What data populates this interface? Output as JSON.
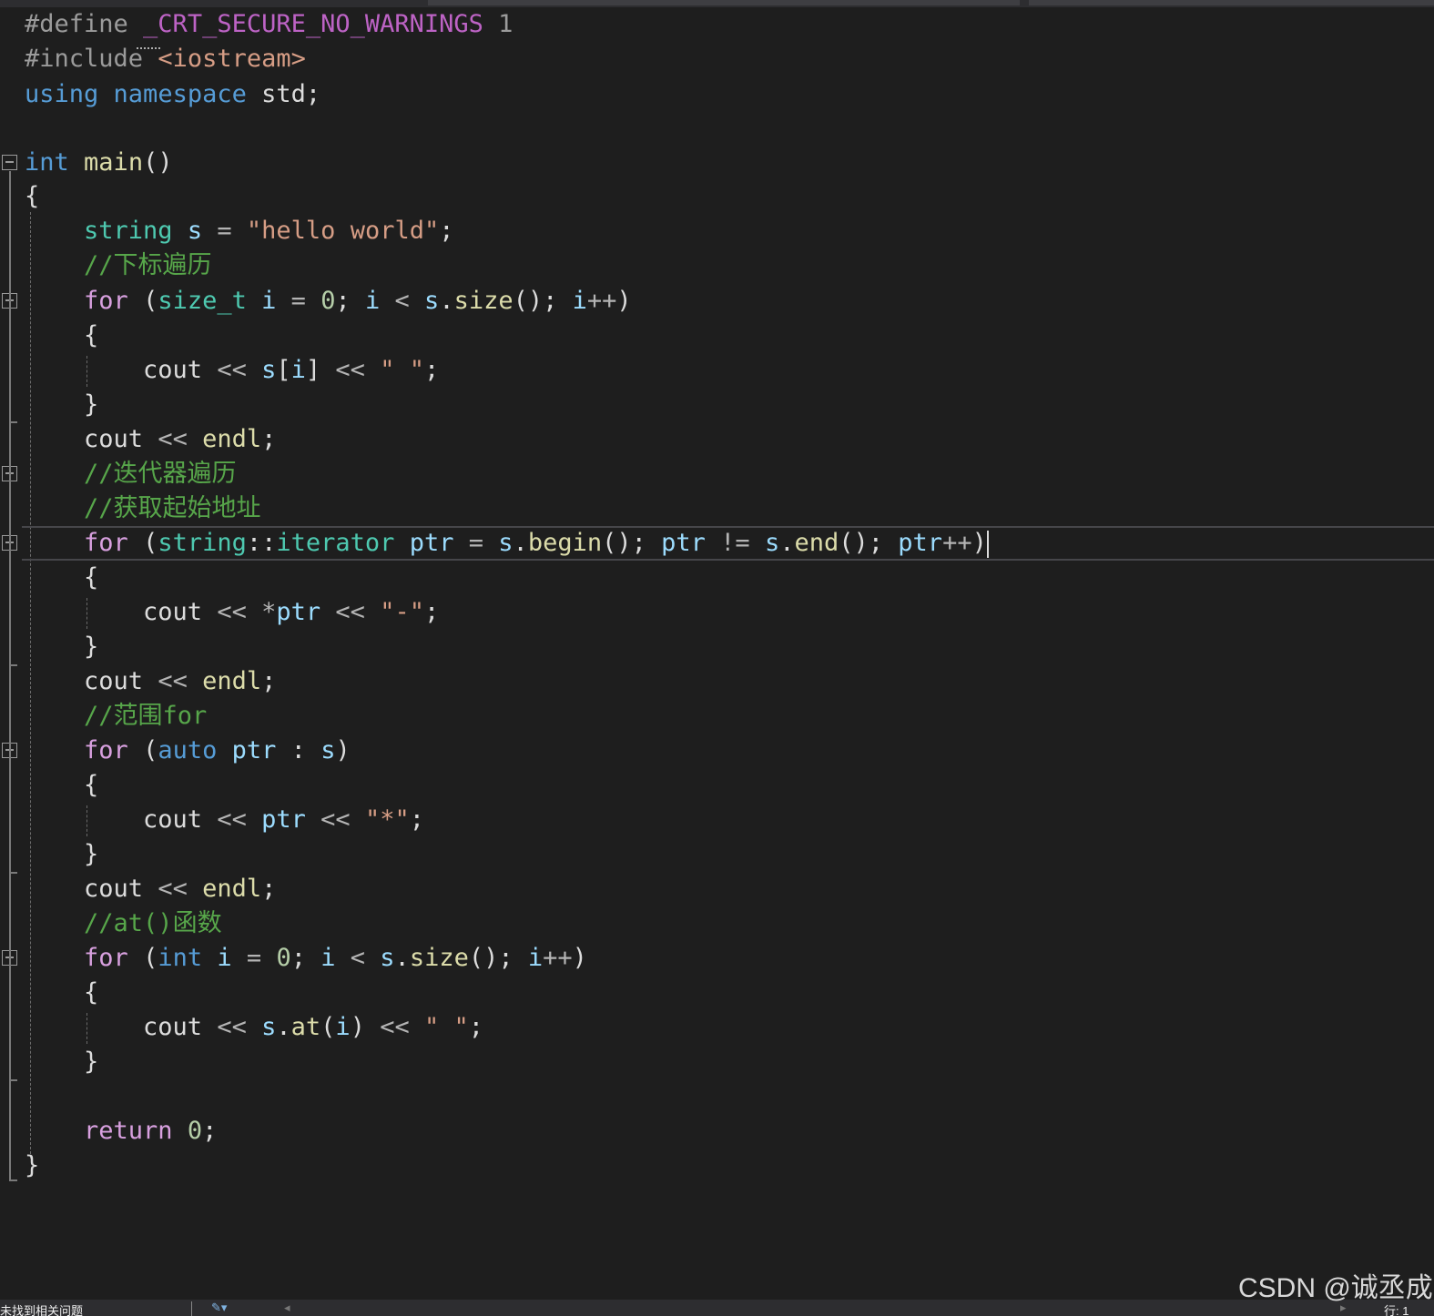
{
  "editor": {
    "lines": [
      [
        {
          "c": "t-pre",
          "t": "#define "
        },
        {
          "c": "t-macro",
          "t": "_CRT_SECURE_NO_WARNINGS"
        },
        {
          "c": "t-pre",
          "t": " 1"
        }
      ],
      [
        {
          "c": "t-pre",
          "t": "#include "
        },
        {
          "c": "t-str",
          "t": "<iostream>"
        }
      ],
      [
        {
          "c": "t-kw",
          "t": "using"
        },
        {
          "c": "",
          "t": " "
        },
        {
          "c": "t-kw",
          "t": "namespace"
        },
        {
          "c": "",
          "t": " std;"
        }
      ],
      [],
      [
        {
          "c": "t-kw",
          "t": "int"
        },
        {
          "c": "",
          "t": " "
        },
        {
          "c": "t-fn",
          "t": "main"
        },
        {
          "c": "",
          "t": "()"
        }
      ],
      [
        {
          "c": "",
          "t": "{"
        }
      ],
      [
        {
          "c": "",
          "t": "    "
        },
        {
          "c": "t-type",
          "t": "string"
        },
        {
          "c": "",
          "t": " "
        },
        {
          "c": "t-var",
          "t": "s"
        },
        {
          "c": "",
          "t": " "
        },
        {
          "c": "t-op",
          "t": "="
        },
        {
          "c": "",
          "t": " "
        },
        {
          "c": "t-str",
          "t": "\"hello world\""
        },
        {
          "c": "",
          "t": ";"
        }
      ],
      [
        {
          "c": "",
          "t": "    "
        },
        {
          "c": "t-com",
          "t": "//下标遍历"
        }
      ],
      [
        {
          "c": "",
          "t": "    "
        },
        {
          "c": "t-ctrl",
          "t": "for"
        },
        {
          "c": "",
          "t": " ("
        },
        {
          "c": "t-type",
          "t": "size_t"
        },
        {
          "c": "",
          "t": " "
        },
        {
          "c": "t-var",
          "t": "i"
        },
        {
          "c": "",
          "t": " "
        },
        {
          "c": "t-op",
          "t": "="
        },
        {
          "c": "",
          "t": " "
        },
        {
          "c": "t-num",
          "t": "0"
        },
        {
          "c": "",
          "t": "; "
        },
        {
          "c": "t-var",
          "t": "i"
        },
        {
          "c": "",
          "t": " "
        },
        {
          "c": "t-op",
          "t": "<"
        },
        {
          "c": "",
          "t": " "
        },
        {
          "c": "t-var",
          "t": "s"
        },
        {
          "c": "",
          "t": "."
        },
        {
          "c": "t-fn",
          "t": "size"
        },
        {
          "c": "",
          "t": "(); "
        },
        {
          "c": "t-var",
          "t": "i"
        },
        {
          "c": "t-op",
          "t": "++"
        },
        {
          "c": "",
          "t": ")"
        }
      ],
      [
        {
          "c": "",
          "t": "    {"
        }
      ],
      [
        {
          "c": "",
          "t": "        cout "
        },
        {
          "c": "t-op",
          "t": "<<"
        },
        {
          "c": "",
          "t": " "
        },
        {
          "c": "t-var",
          "t": "s"
        },
        {
          "c": "",
          "t": "["
        },
        {
          "c": "t-var",
          "t": "i"
        },
        {
          "c": "",
          "t": "] "
        },
        {
          "c": "t-op",
          "t": "<<"
        },
        {
          "c": "",
          "t": " "
        },
        {
          "c": "t-str",
          "t": "\" \""
        },
        {
          "c": "",
          "t": ";"
        }
      ],
      [
        {
          "c": "",
          "t": "    }"
        }
      ],
      [
        {
          "c": "",
          "t": "    cout "
        },
        {
          "c": "t-op",
          "t": "<<"
        },
        {
          "c": "",
          "t": " "
        },
        {
          "c": "t-fn",
          "t": "endl"
        },
        {
          "c": "",
          "t": ";"
        }
      ],
      [
        {
          "c": "",
          "t": "    "
        },
        {
          "c": "t-com",
          "t": "//迭代器遍历"
        }
      ],
      [
        {
          "c": "",
          "t": "    "
        },
        {
          "c": "t-com",
          "t": "//获取起始地址"
        }
      ],
      [
        {
          "c": "",
          "t": "    "
        },
        {
          "c": "t-ctrl",
          "t": "for"
        },
        {
          "c": "",
          "t": " ("
        },
        {
          "c": "t-type",
          "t": "string"
        },
        {
          "c": "",
          "t": "::"
        },
        {
          "c": "t-type",
          "t": "iterator"
        },
        {
          "c": "",
          "t": " "
        },
        {
          "c": "t-var",
          "t": "ptr"
        },
        {
          "c": "",
          "t": " "
        },
        {
          "c": "t-op",
          "t": "="
        },
        {
          "c": "",
          "t": " "
        },
        {
          "c": "t-var",
          "t": "s"
        },
        {
          "c": "",
          "t": "."
        },
        {
          "c": "t-fn",
          "t": "begin"
        },
        {
          "c": "",
          "t": "(); "
        },
        {
          "c": "t-var",
          "t": "ptr"
        },
        {
          "c": "",
          "t": " "
        },
        {
          "c": "t-op",
          "t": "!="
        },
        {
          "c": "",
          "t": " "
        },
        {
          "c": "t-var",
          "t": "s"
        },
        {
          "c": "",
          "t": "."
        },
        {
          "c": "t-fn",
          "t": "end"
        },
        {
          "c": "",
          "t": "(); "
        },
        {
          "c": "t-var",
          "t": "ptr"
        },
        {
          "c": "t-op",
          "t": "++"
        },
        {
          "c": "",
          "t": ")"
        }
      ],
      [
        {
          "c": "",
          "t": "    {"
        }
      ],
      [
        {
          "c": "",
          "t": "        cout "
        },
        {
          "c": "t-op",
          "t": "<<"
        },
        {
          "c": "",
          "t": " "
        },
        {
          "c": "t-op",
          "t": "*"
        },
        {
          "c": "t-var",
          "t": "ptr"
        },
        {
          "c": "",
          "t": " "
        },
        {
          "c": "t-op",
          "t": "<<"
        },
        {
          "c": "",
          "t": " "
        },
        {
          "c": "t-str",
          "t": "\"-\""
        },
        {
          "c": "",
          "t": ";"
        }
      ],
      [
        {
          "c": "",
          "t": "    }"
        }
      ],
      [
        {
          "c": "",
          "t": "    cout "
        },
        {
          "c": "t-op",
          "t": "<<"
        },
        {
          "c": "",
          "t": " "
        },
        {
          "c": "t-fn",
          "t": "endl"
        },
        {
          "c": "",
          "t": ";"
        }
      ],
      [
        {
          "c": "",
          "t": "    "
        },
        {
          "c": "t-com",
          "t": "//范围for"
        }
      ],
      [
        {
          "c": "",
          "t": "    "
        },
        {
          "c": "t-ctrl",
          "t": "for"
        },
        {
          "c": "",
          "t": " ("
        },
        {
          "c": "t-kw",
          "t": "auto"
        },
        {
          "c": "",
          "t": " "
        },
        {
          "c": "t-var",
          "t": "ptr"
        },
        {
          "c": "",
          "t": " : "
        },
        {
          "c": "t-var",
          "t": "s"
        },
        {
          "c": "",
          "t": ")"
        }
      ],
      [
        {
          "c": "",
          "t": "    {"
        }
      ],
      [
        {
          "c": "",
          "t": "        cout "
        },
        {
          "c": "t-op",
          "t": "<<"
        },
        {
          "c": "",
          "t": " "
        },
        {
          "c": "t-var",
          "t": "ptr"
        },
        {
          "c": "",
          "t": " "
        },
        {
          "c": "t-op",
          "t": "<<"
        },
        {
          "c": "",
          "t": " "
        },
        {
          "c": "t-str",
          "t": "\"*\""
        },
        {
          "c": "",
          "t": ";"
        }
      ],
      [
        {
          "c": "",
          "t": "    }"
        }
      ],
      [
        {
          "c": "",
          "t": "    cout "
        },
        {
          "c": "t-op",
          "t": "<<"
        },
        {
          "c": "",
          "t": " "
        },
        {
          "c": "t-fn",
          "t": "endl"
        },
        {
          "c": "",
          "t": ";"
        }
      ],
      [
        {
          "c": "",
          "t": "    "
        },
        {
          "c": "t-com",
          "t": "//at()函数"
        }
      ],
      [
        {
          "c": "",
          "t": "    "
        },
        {
          "c": "t-ctrl",
          "t": "for"
        },
        {
          "c": "",
          "t": " ("
        },
        {
          "c": "t-kw",
          "t": "int"
        },
        {
          "c": "",
          "t": " "
        },
        {
          "c": "t-var",
          "t": "i"
        },
        {
          "c": "",
          "t": " "
        },
        {
          "c": "t-op",
          "t": "="
        },
        {
          "c": "",
          "t": " "
        },
        {
          "c": "t-num",
          "t": "0"
        },
        {
          "c": "",
          "t": "; "
        },
        {
          "c": "t-var",
          "t": "i"
        },
        {
          "c": "",
          "t": " "
        },
        {
          "c": "t-op",
          "t": "<"
        },
        {
          "c": "",
          "t": " "
        },
        {
          "c": "t-var",
          "t": "s"
        },
        {
          "c": "",
          "t": "."
        },
        {
          "c": "t-fn",
          "t": "size"
        },
        {
          "c": "",
          "t": "(); "
        },
        {
          "c": "t-var",
          "t": "i"
        },
        {
          "c": "t-op",
          "t": "++"
        },
        {
          "c": "",
          "t": ")"
        }
      ],
      [
        {
          "c": "",
          "t": "    {"
        }
      ],
      [
        {
          "c": "",
          "t": "        cout "
        },
        {
          "c": "t-op",
          "t": "<<"
        },
        {
          "c": "",
          "t": " "
        },
        {
          "c": "t-var",
          "t": "s"
        },
        {
          "c": "",
          "t": "."
        },
        {
          "c": "t-fn",
          "t": "at"
        },
        {
          "c": "",
          "t": "("
        },
        {
          "c": "t-var",
          "t": "i"
        },
        {
          "c": "",
          "t": ") "
        },
        {
          "c": "t-op",
          "t": "<<"
        },
        {
          "c": "",
          "t": " "
        },
        {
          "c": "t-str",
          "t": "\" \""
        },
        {
          "c": "",
          "t": ";"
        }
      ],
      [
        {
          "c": "",
          "t": "    }"
        }
      ],
      [],
      [
        {
          "c": "",
          "t": "    "
        },
        {
          "c": "t-ctrl",
          "t": "return"
        },
        {
          "c": "",
          "t": " "
        },
        {
          "c": "t-num",
          "t": "0"
        },
        {
          "c": "",
          "t": ";"
        }
      ],
      [
        {
          "c": "",
          "t": "}"
        }
      ]
    ],
    "current_line": 15,
    "fold_lines": [
      4,
      8,
      13,
      15,
      21,
      27
    ]
  },
  "colors": {
    "background": "#1e1e1e",
    "keyword": "#569cd6",
    "control": "#d8a0df",
    "function": "#dcdcaa",
    "string": "#d69d85",
    "comment": "#57a64a",
    "number": "#b5cea8",
    "type": "#4ec9b0",
    "variable": "#9cdcfe",
    "macro": "#bd63c5",
    "preprocessor": "#9b9b9b"
  },
  "status_bar": {
    "issues_text": "未找到相关问题",
    "row_text": "行: 1"
  },
  "watermark": "CSDN @诚丞成"
}
